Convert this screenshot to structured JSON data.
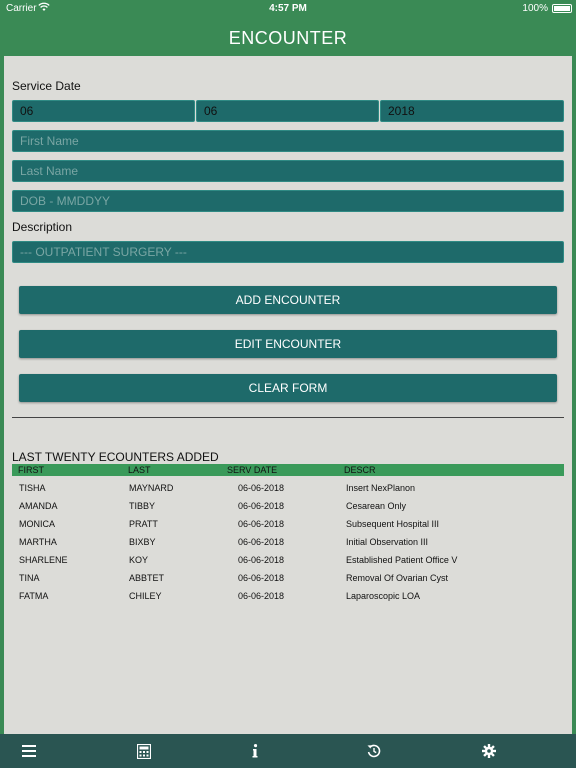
{
  "status_bar": {
    "carrier": "Carrier",
    "time": "4:57 PM",
    "battery": "100%"
  },
  "title": "ENCOUNTER",
  "form": {
    "service_date_label": "Service Date",
    "month": "06",
    "day": "06",
    "year": "2018",
    "first_name_placeholder": "First Name",
    "last_name_placeholder": "Last Name",
    "dob_placeholder": "DOB - MMDDYY",
    "description_label": "Description",
    "description_value": "--- OUTPATIENT SURGERY ---"
  },
  "buttons": {
    "add": "ADD ENCOUNTER",
    "edit": "EDIT ENCOUNTER",
    "clear": "CLEAR FORM"
  },
  "table": {
    "title": "LAST TWENTY ECOUNTERS ADDED",
    "headers": [
      "FIRST",
      "LAST",
      "SERV DATE",
      "DESCR"
    ],
    "rows": [
      [
        "TISHA",
        "MAYNARD",
        "06-06-2018",
        "Insert NexPlanon"
      ],
      [
        "AMANDA",
        "TIBBY",
        "06-06-2018",
        "Cesarean Only"
      ],
      [
        "MONICA",
        "PRATT",
        "06-06-2018",
        "Subsequent Hospital III"
      ],
      [
        "MARTHA",
        "BIXBY",
        "06-06-2018",
        "Initial Observation III"
      ],
      [
        "SHARLENE",
        "KOY",
        "06-06-2018",
        "Established Patient Office V"
      ],
      [
        "TINA",
        "ABBTET",
        "06-06-2018",
        "Removal Of Ovarian Cyst"
      ],
      [
        "FATMA",
        "CHILEY",
        "06-06-2018",
        "Laparoscopic LOA"
      ]
    ]
  },
  "tab_bar": {
    "icons": [
      "menu-icon",
      "calculator-icon",
      "info-icon",
      "history-icon",
      "gear-icon"
    ]
  },
  "colors": {
    "header_green": "#3a8a55",
    "field_teal": "#1e6a6a",
    "table_header_green": "#3a9a5a",
    "tab_bar": "#2a5552",
    "background": "#dcdcd8"
  }
}
